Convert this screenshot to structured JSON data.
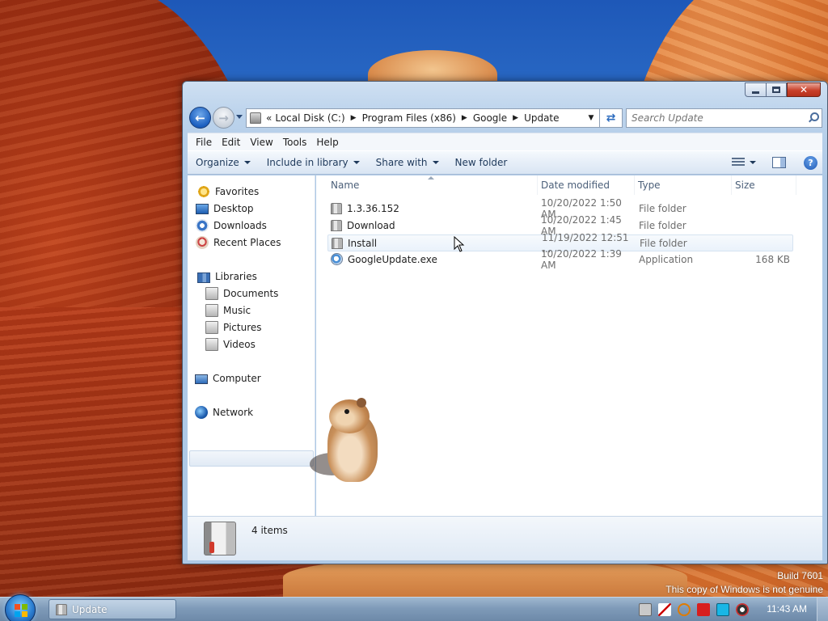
{
  "window": {
    "title": "Update",
    "address": {
      "overflow": "«",
      "crumbs": [
        "Local Disk (C:)",
        "Program Files (x86)",
        "Google",
        "Update"
      ]
    },
    "search_placeholder": "Search Update",
    "menu": [
      "File",
      "Edit",
      "View",
      "Tools",
      "Help"
    ],
    "commands": {
      "organize": "Organize",
      "include_in_library": "Include in library",
      "share_with": "Share with",
      "new_folder": "New folder"
    },
    "nav": {
      "favorites": "Favorites",
      "desktop": "Desktop",
      "downloads": "Downloads",
      "recent_places": "Recent Places",
      "libraries": "Libraries",
      "documents": "Documents",
      "music": "Music",
      "pictures": "Pictures",
      "videos": "Videos",
      "computer": "Computer",
      "network": "Network"
    },
    "columns": {
      "name": "Name",
      "date": "Date modified",
      "type": "Type",
      "size": "Size"
    },
    "files": [
      {
        "name": "1.3.36.152",
        "date": "10/20/2022 1:50 AM",
        "type": "File folder",
        "size": ""
      },
      {
        "name": "Download",
        "date": "10/20/2022 1:45 AM",
        "type": "File folder",
        "size": ""
      },
      {
        "name": "Install",
        "date": "11/19/2022 12:51 ...",
        "type": "File folder",
        "size": ""
      },
      {
        "name": "GoogleUpdate.exe",
        "date": "10/20/2022 1:39 AM",
        "type": "Application",
        "size": "168 KB"
      }
    ],
    "status": "4 items"
  },
  "desktop": {
    "watermark_build": "Build 7601",
    "watermark_genuine": "This copy of Windows is not genuine"
  },
  "taskbar": {
    "task_label": "Update",
    "clock": "11:43 AM"
  },
  "colors": {
    "accent": "#1d5db0",
    "close_button": "#c9402a",
    "taskbar": "#7f9bb9"
  }
}
